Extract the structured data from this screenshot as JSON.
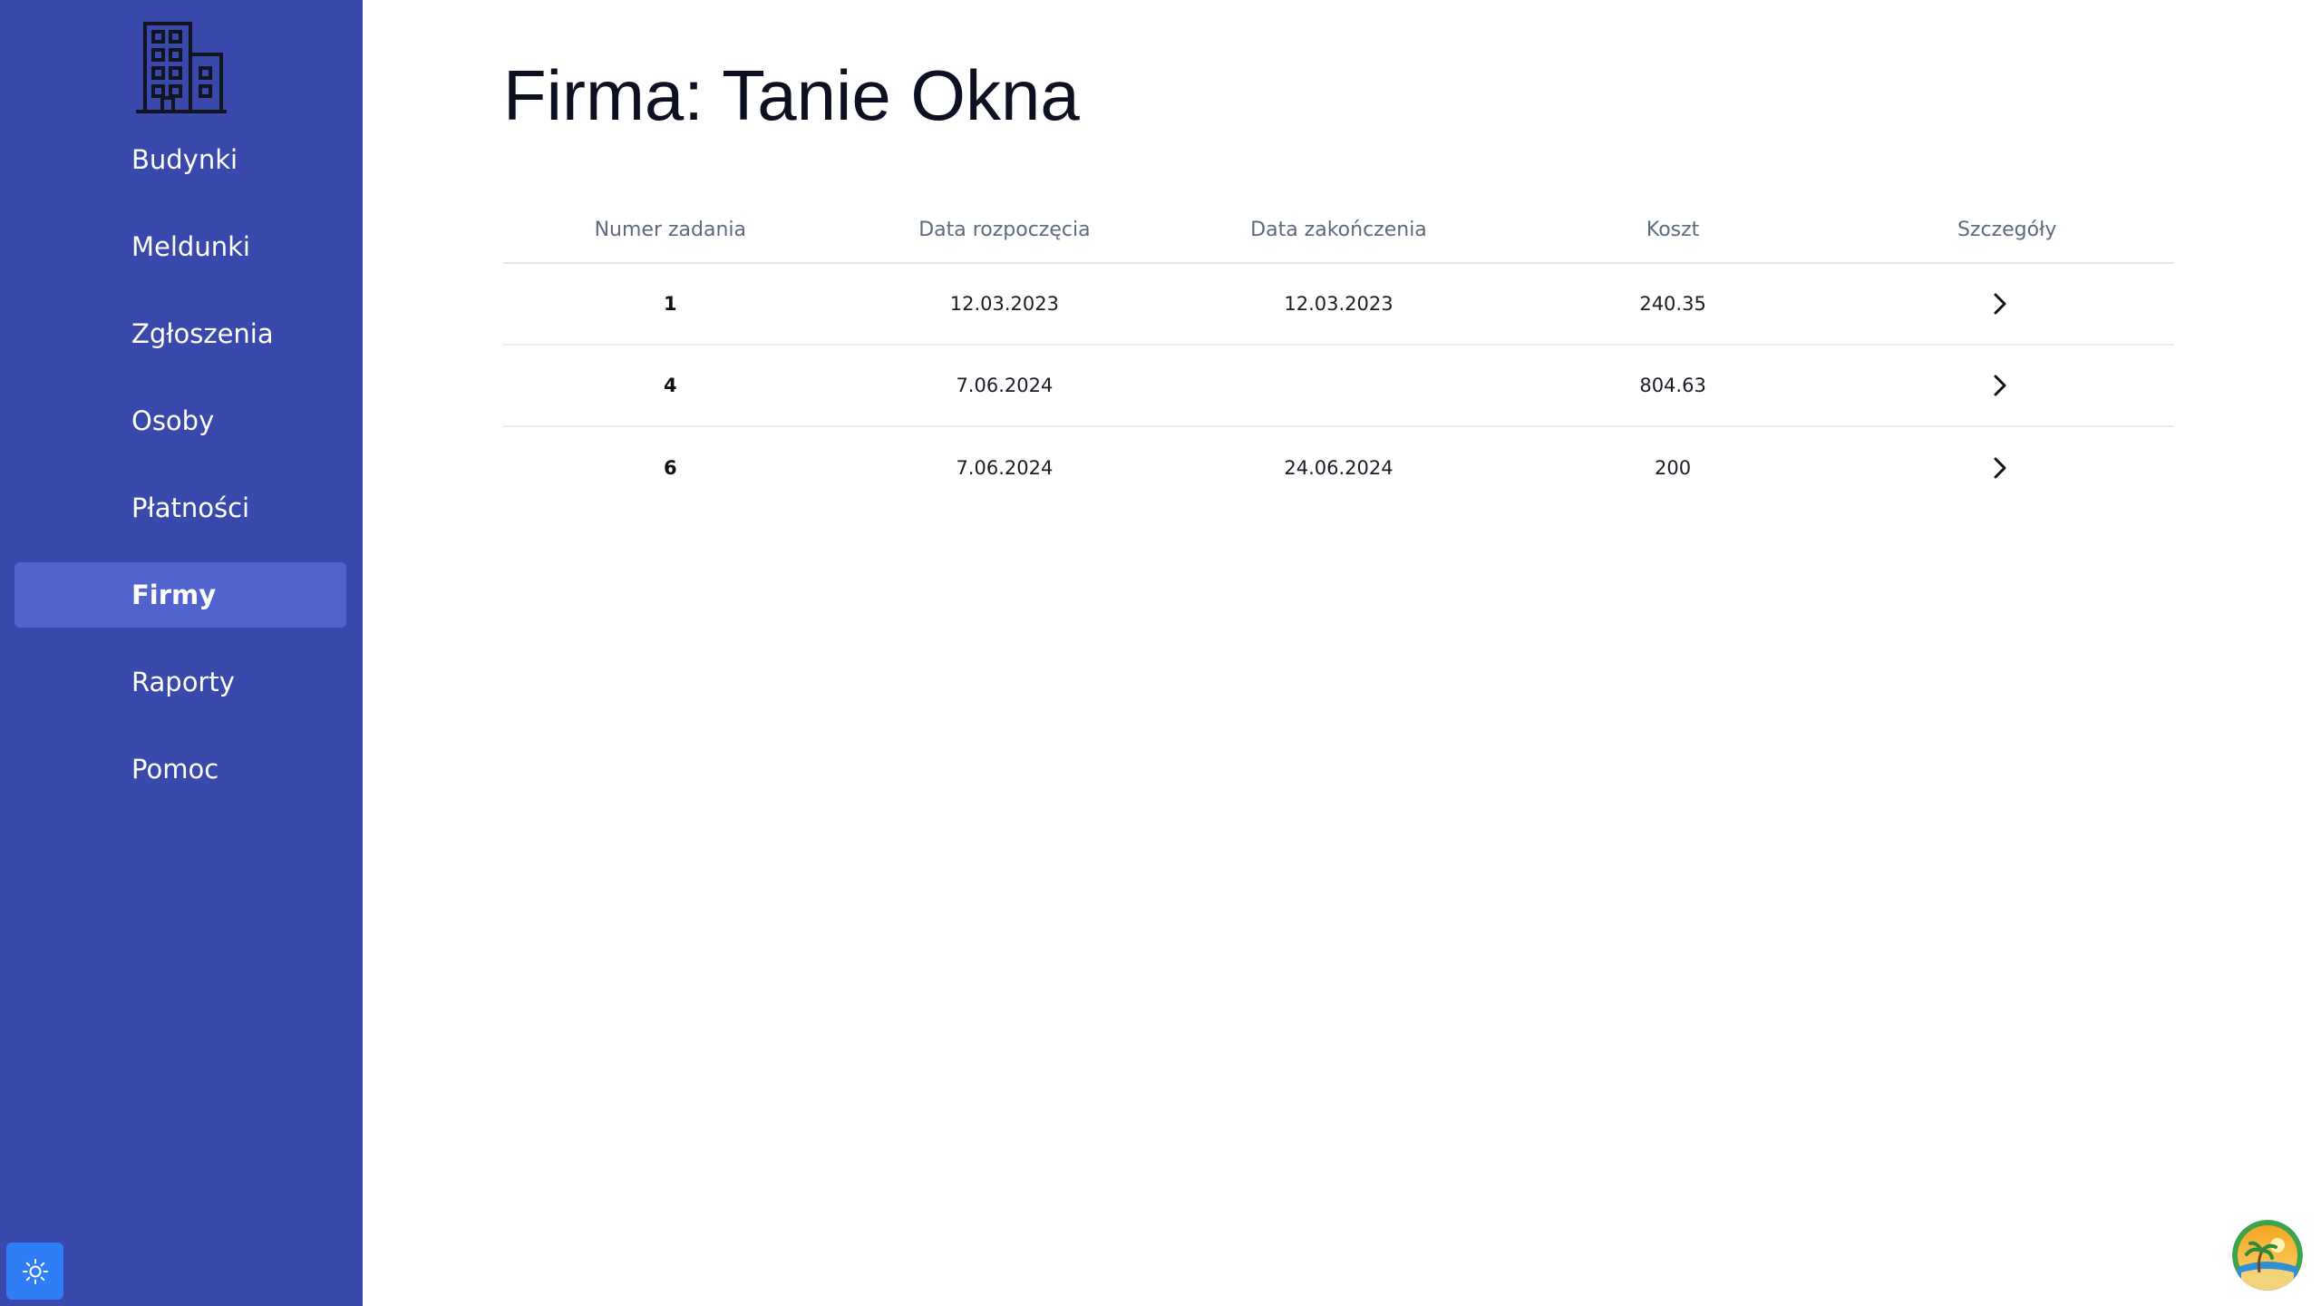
{
  "sidebar": {
    "logo_icon": "building-icon",
    "items": [
      {
        "label": "Budynki"
      },
      {
        "label": "Meldunki"
      },
      {
        "label": "Zgłoszenia"
      },
      {
        "label": "Osoby"
      },
      {
        "label": "Płatności"
      },
      {
        "label": "Firmy",
        "active": true
      },
      {
        "label": "Raporty"
      },
      {
        "label": "Pomoc"
      }
    ],
    "theme_toggle_icon": "sun-icon",
    "background_color": "#3949ab",
    "active_color": "#5163cf"
  },
  "main": {
    "title": "Firma: Tanie Okna",
    "table": {
      "headers": [
        "Numer zadania",
        "Data rozpoczęcia",
        "Data zakończenia",
        "Koszt",
        "Szczegóły"
      ],
      "rows": [
        {
          "number": "1",
          "start": "12.03.2023",
          "end": "12.03.2023",
          "cost": "240.35",
          "details_icon": "chevron-right-icon"
        },
        {
          "number": "4",
          "start": "7.06.2024",
          "end": "",
          "cost": "804.63",
          "details_icon": "chevron-right-icon"
        },
        {
          "number": "6",
          "start": "7.06.2024",
          "end": "24.06.2024",
          "cost": "200",
          "details_icon": "chevron-right-icon"
        }
      ]
    }
  },
  "avatar_icon": "palm-beach-avatar-icon"
}
